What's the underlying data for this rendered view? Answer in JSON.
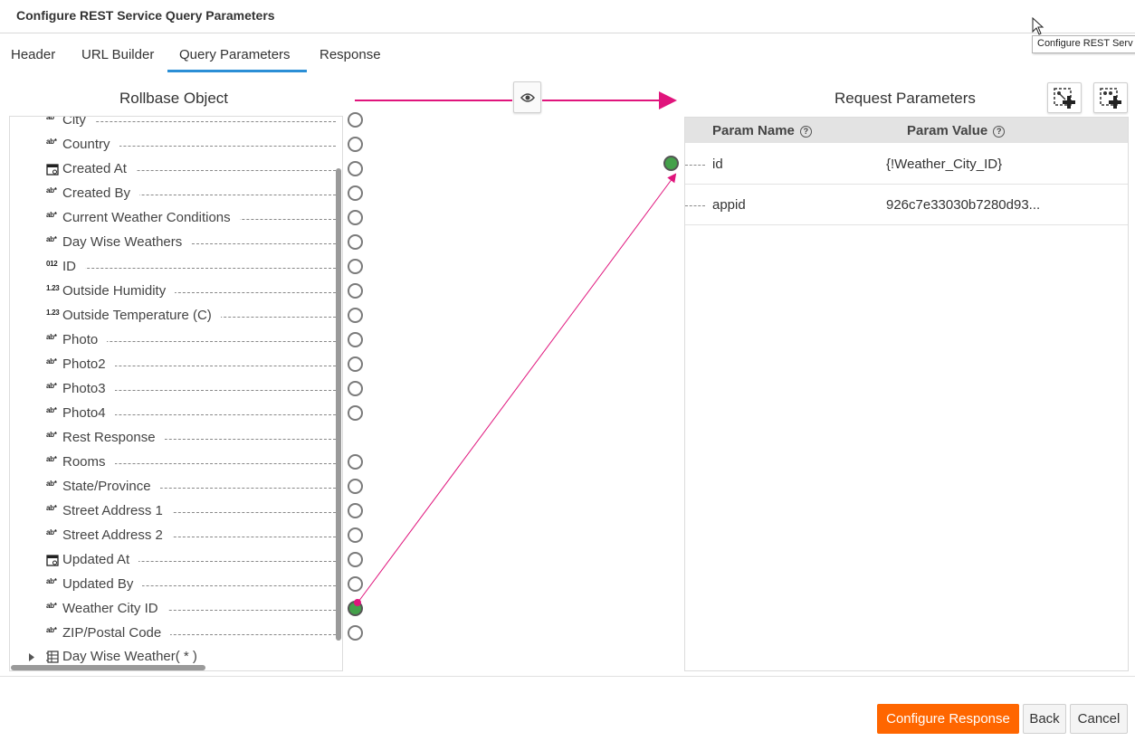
{
  "dialog": {
    "title": "Configure REST Service Query Parameters"
  },
  "tooltip": {
    "text": "Configure REST Serv"
  },
  "tabs": [
    {
      "label": "Header"
    },
    {
      "label": "URL Builder"
    },
    {
      "label": "Query Parameters",
      "active": true
    },
    {
      "label": "Response"
    }
  ],
  "left": {
    "title": "Rollbase Object",
    "fields": [
      {
        "icon": "ab*",
        "label": "City"
      },
      {
        "icon": "ab*",
        "label": "Country"
      },
      {
        "icon": "calendar-icon",
        "label": "Created At"
      },
      {
        "icon": "ab*",
        "label": "Created By"
      },
      {
        "icon": "ab*",
        "label": "Current Weather Conditions"
      },
      {
        "icon": "ab*",
        "label": "Day Wise Weathers"
      },
      {
        "icon": "012",
        "label": "ID"
      },
      {
        "icon": "1.23",
        "label": "Outside Humidity"
      },
      {
        "icon": "1.23",
        "label": "Outside Temperature (C)"
      },
      {
        "icon": "ab*",
        "label": "Photo"
      },
      {
        "icon": "ab*",
        "label": "Photo2"
      },
      {
        "icon": "ab*",
        "label": "Photo3"
      },
      {
        "icon": "ab*",
        "label": "Photo4"
      },
      {
        "icon": "ab*",
        "label": "Rest Response"
      },
      {
        "icon": "ab*",
        "label": "Rooms"
      },
      {
        "icon": "ab*",
        "label": "State/Province"
      },
      {
        "icon": "ab*",
        "label": "Street Address 1"
      },
      {
        "icon": "ab*",
        "label": "Street Address 2"
      },
      {
        "icon": "calendar-icon",
        "label": "Updated At"
      },
      {
        "icon": "ab*",
        "label": "Updated By"
      },
      {
        "icon": "ab*",
        "label": "Weather City ID"
      },
      {
        "icon": "ab*",
        "label": "ZIP/Postal Code"
      }
    ],
    "group": {
      "label": "Day Wise Weather( * )"
    }
  },
  "right": {
    "title": "Request Parameters",
    "columns": {
      "name": "Param Name",
      "value": "Param Value"
    },
    "rows": [
      {
        "name": "id",
        "value": "{!Weather_City_ID}"
      },
      {
        "name": "appid",
        "value": "926c7e33030b7280d93..."
      }
    ]
  },
  "colors": {
    "accent": "#ff6600",
    "link": "#e0147c",
    "mapped": "#44a04a",
    "tab": "#2b8fd6"
  },
  "footer": {
    "configure_response": "Configure Response",
    "back": "Back",
    "cancel": "Cancel"
  }
}
